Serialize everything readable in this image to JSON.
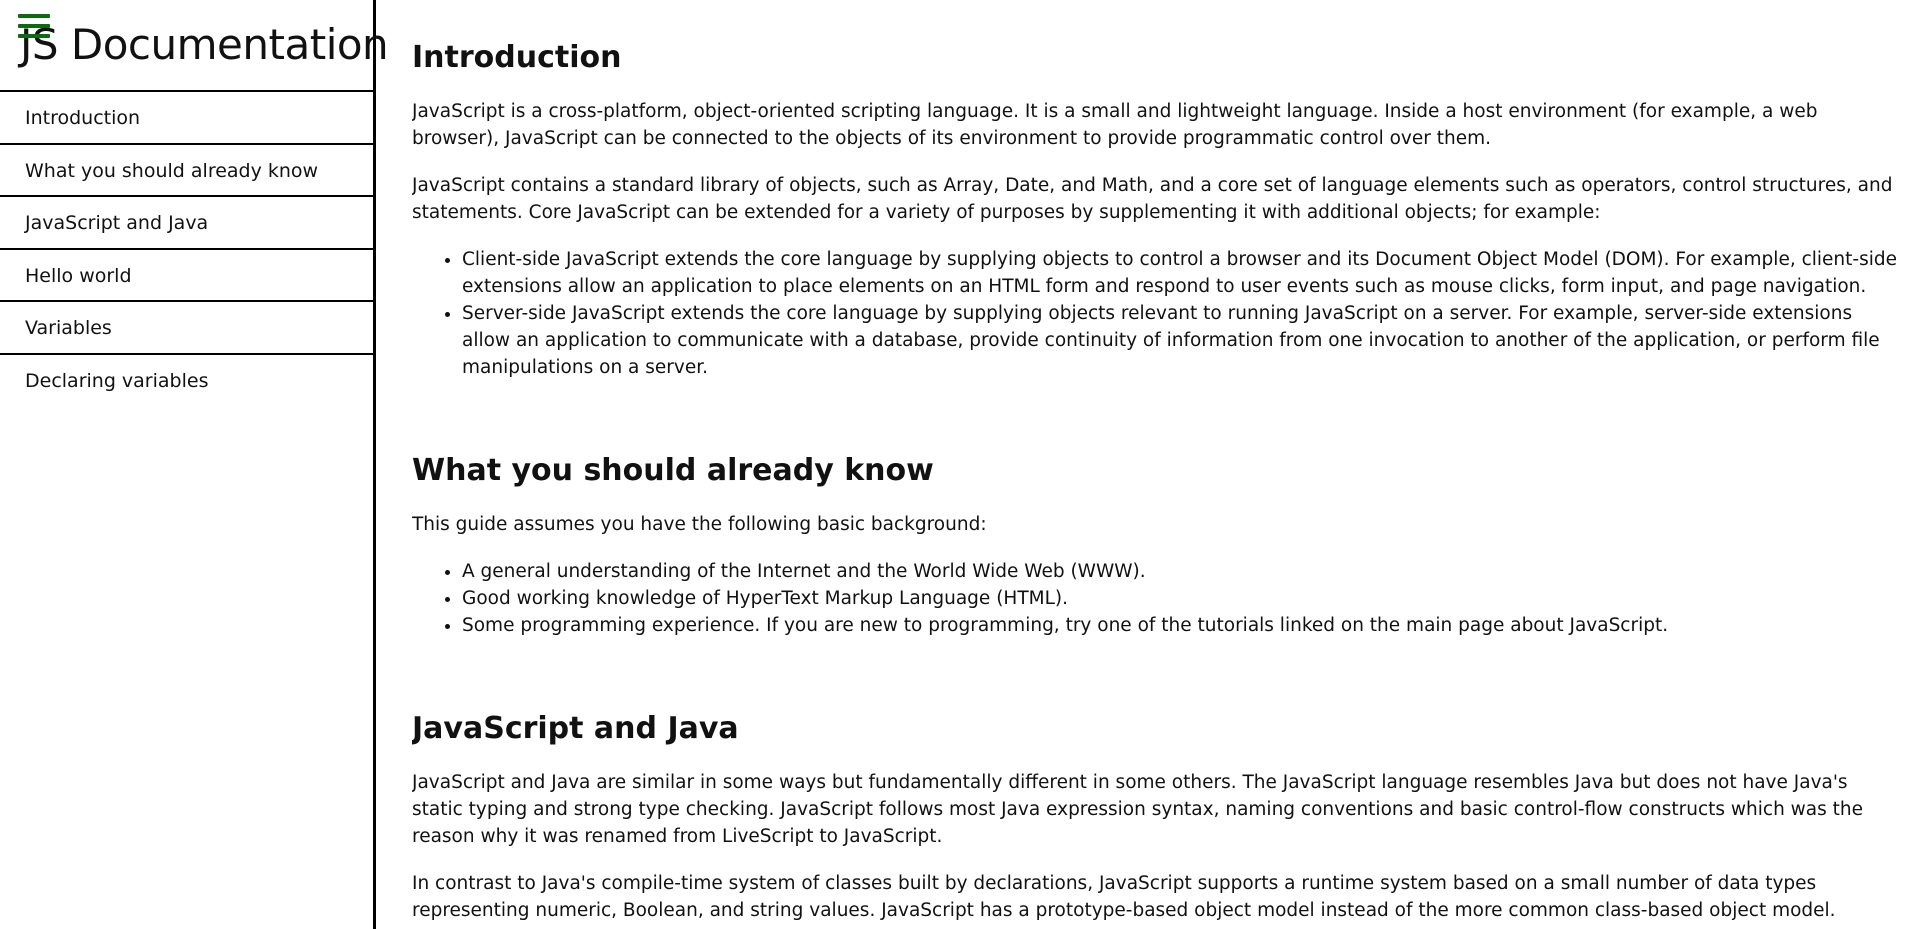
{
  "nav": {
    "title": "JS Documentation",
    "items": [
      "Introduction",
      "What you should already know",
      "JavaScript and Java",
      "Hello world",
      "Variables",
      "Declaring variables"
    ]
  },
  "sections": {
    "intro": {
      "title": "Introduction",
      "p1": "JavaScript is a cross-platform, object-oriented scripting language. It is a small and lightweight language. Inside a host environment (for example, a web browser), JavaScript can be connected to the objects of its environment to provide programmatic control over them.",
      "p2": "JavaScript contains a standard library of objects, such as Array, Date, and Math, and a core set of language elements such as operators, control structures, and statements. Core JavaScript can be extended for a variety of purposes by supplementing it with additional objects; for example:",
      "list": [
        "Client-side JavaScript extends the core language by supplying objects to control a browser and its Document Object Model (DOM). For example, client-side extensions allow an application to place elements on an HTML form and respond to user events such as mouse clicks, form input, and page navigation.",
        "Server-side JavaScript extends the core language by supplying objects relevant to running JavaScript on a server. For example, server-side extensions allow an application to communicate with a database, provide continuity of information from one invocation to another of the application, or perform file manipulations on a server."
      ]
    },
    "know": {
      "title": "What you should already know",
      "p1": "This guide assumes you have the following basic background:",
      "list": [
        "A general understanding of the Internet and the World Wide Web (WWW).",
        "Good working knowledge of HyperText Markup Language (HTML).",
        "Some programming experience. If you are new to programming, try one of the tutorials linked on the main page about JavaScript."
      ]
    },
    "java": {
      "title": "JavaScript and Java",
      "p1": "JavaScript and Java are similar in some ways but fundamentally different in some others. The JavaScript language resembles Java but does not have Java's static typing and strong type checking. JavaScript follows most Java expression syntax, naming conventions and basic control-flow constructs which was the reason why it was renamed from LiveScript to JavaScript.",
      "p2": "In contrast to Java's compile-time system of classes built by declarations, JavaScript supports a runtime system based on a small number of data types representing numeric, Boolean, and string values. JavaScript has a prototype-based object model instead of the more common class-based object model."
    }
  },
  "colors": {
    "menu_icon": "#0b6b10",
    "border": "#000000"
  }
}
